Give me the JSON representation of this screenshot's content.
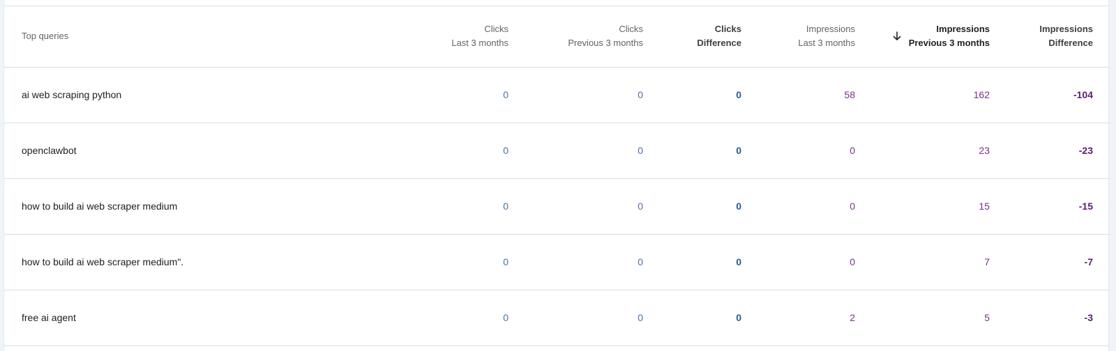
{
  "headers": {
    "query": "Top queries",
    "clicks_last": [
      "Clicks",
      "Last 3 months"
    ],
    "clicks_prev": [
      "Clicks",
      "Previous 3 months"
    ],
    "clicks_diff": [
      "Clicks",
      "Difference"
    ],
    "impr_last": [
      "Impressions",
      "Last 3 months"
    ],
    "impr_prev": [
      "Impressions",
      "Previous 3 months"
    ],
    "impr_diff": [
      "Impressions",
      "Difference"
    ]
  },
  "sort": {
    "column": "impr_prev",
    "direction": "descending",
    "icon": "arrow-down-icon"
  },
  "colors": {
    "clicks": "#4a6fa5",
    "impressions": "#7b2f8e",
    "border": "#dadce0"
  },
  "rows": [
    {
      "query": "ai web scraping python",
      "clicks_last": "0",
      "clicks_prev": "0",
      "clicks_diff": "0",
      "impr_last": "58",
      "impr_prev": "162",
      "impr_diff": "-104"
    },
    {
      "query": "openclawbot",
      "clicks_last": "0",
      "clicks_prev": "0",
      "clicks_diff": "0",
      "impr_last": "0",
      "impr_prev": "23",
      "impr_diff": "-23"
    },
    {
      "query": "how to build ai web scraper medium",
      "clicks_last": "0",
      "clicks_prev": "0",
      "clicks_diff": "0",
      "impr_last": "0",
      "impr_prev": "15",
      "impr_diff": "-15"
    },
    {
      "query": "how to build ai web scraper medium\".",
      "clicks_last": "0",
      "clicks_prev": "0",
      "clicks_diff": "0",
      "impr_last": "0",
      "impr_prev": "7",
      "impr_diff": "-7"
    },
    {
      "query": "free ai agent",
      "clicks_last": "0",
      "clicks_prev": "0",
      "clicks_diff": "0",
      "impr_last": "2",
      "impr_prev": "5",
      "impr_diff": "-3"
    }
  ]
}
